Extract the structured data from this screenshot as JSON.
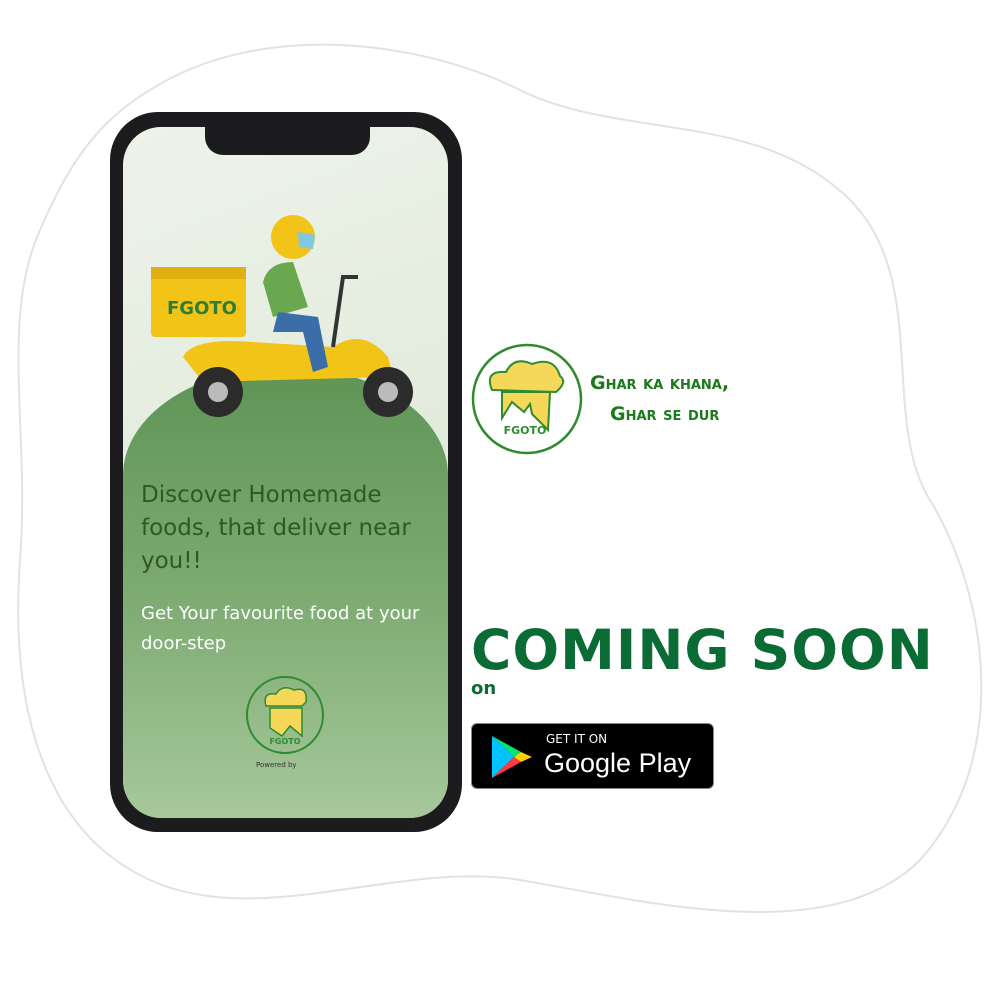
{
  "phone": {
    "box_brand": "FGOTO",
    "headline": "Discover Homemade foods, that deliver near you!!",
    "subtext": "Get Your favourite food at your door-step",
    "logo_text": "FGOTO",
    "powered_by": "Powered by"
  },
  "brand": {
    "logo_text": "FGOTO",
    "tagline_line1": "Ghar ka khana,",
    "tagline_line2": "Ghar se dur"
  },
  "cta": {
    "coming_soon": "COMING SOON",
    "on": "on",
    "badge_small": "GET IT ON",
    "badge_large": "Google Play"
  },
  "colors": {
    "brand_green": "#0b6b34",
    "logo_yellow": "#f5d85a",
    "screen_green": "#5f9456"
  },
  "icons": [
    "chef-hat-logo-icon",
    "google-play-icon",
    "delivery-scooter-illustration"
  ]
}
